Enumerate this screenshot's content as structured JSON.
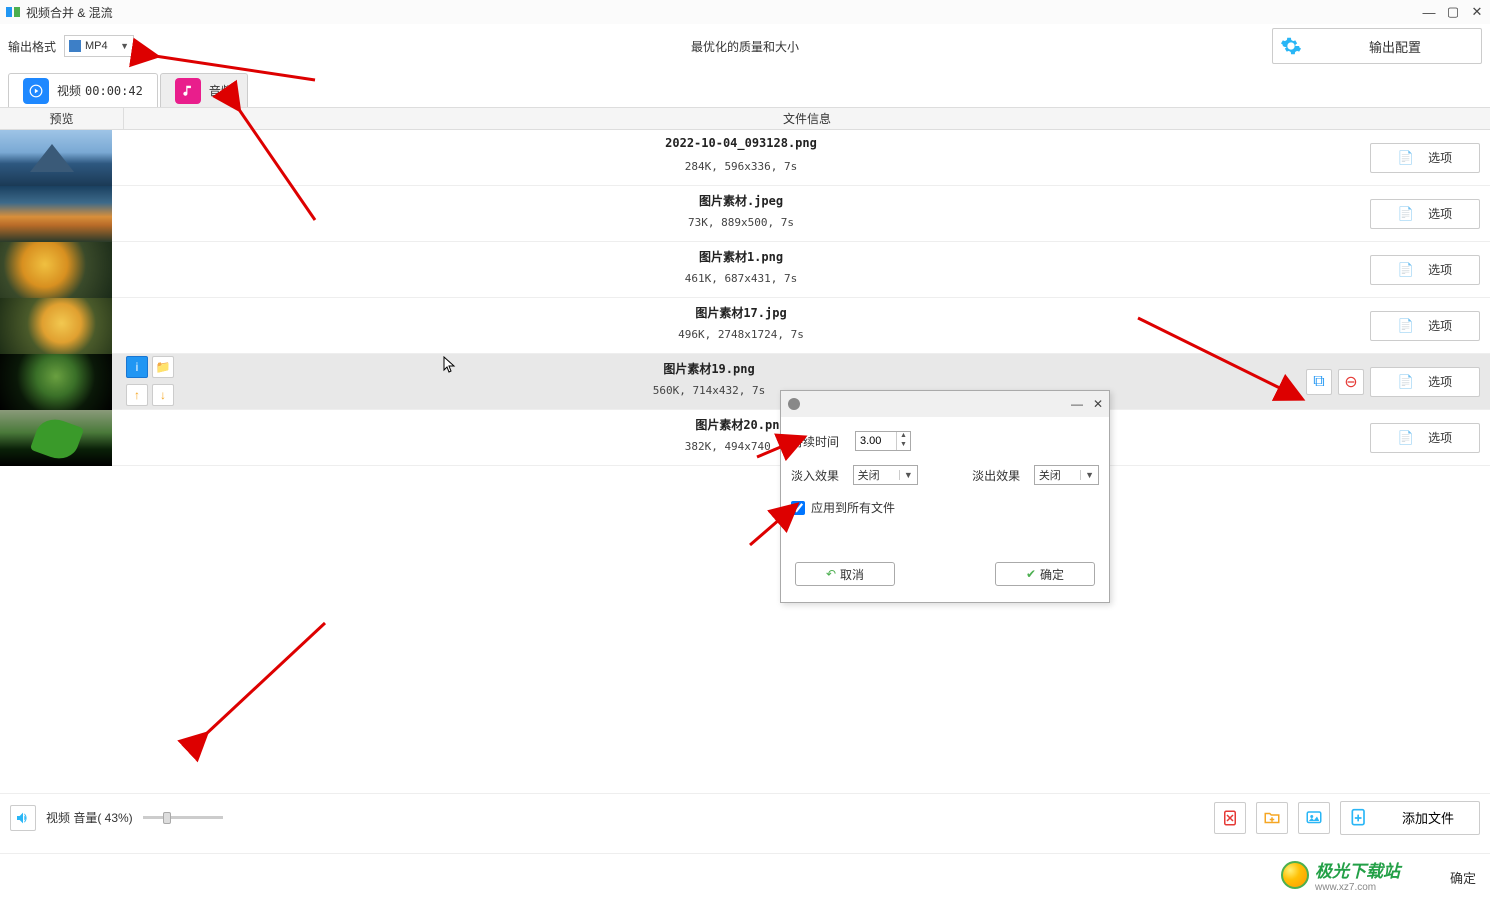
{
  "titlebar": {
    "title": "视频合并 & 混流"
  },
  "toprow": {
    "format_label": "输出格式",
    "format_value": "MP4",
    "center_text": "最优化的质量和大小",
    "outconfig_label": "输出配置"
  },
  "tabs": {
    "video": {
      "label": "视频",
      "time": "00:00:42"
    },
    "audio": {
      "label": "音频"
    }
  },
  "columns": {
    "preview": "预览",
    "fileinfo": "文件信息"
  },
  "files": [
    {
      "name": "2022-10-04_093128.png",
      "info": "284K, 596x336, 7s"
    },
    {
      "name": "图片素材.jpeg",
      "info": "73K, 889x500, 7s"
    },
    {
      "name": "图片素材1.png",
      "info": "461K, 687x431, 7s"
    },
    {
      "name": "图片素材17.jpg",
      "info": "496K, 2748x1724, 7s"
    },
    {
      "name": "图片素材19.png",
      "info": "560K, 714x432, 7s"
    },
    {
      "name": "图片素材20.png",
      "info": "382K, 494x740, 7s"
    }
  ],
  "options_label": "选项",
  "dialog": {
    "duration_label": "持续时间",
    "duration_value": "3.00",
    "fadein_label": "淡入效果",
    "fadein_value": "关闭",
    "fadeout_label": "淡出效果",
    "fadeout_value": "关闭",
    "applyall_label": "应用到所有文件",
    "cancel": "取消",
    "ok": "确定"
  },
  "bottom": {
    "volume_label": "视频 音量( 43%)",
    "addfile_label": "添加文件"
  },
  "footer": {
    "ok": "确定",
    "watermark": "极光下载站",
    "watermark_url": "www.xz7.com"
  }
}
